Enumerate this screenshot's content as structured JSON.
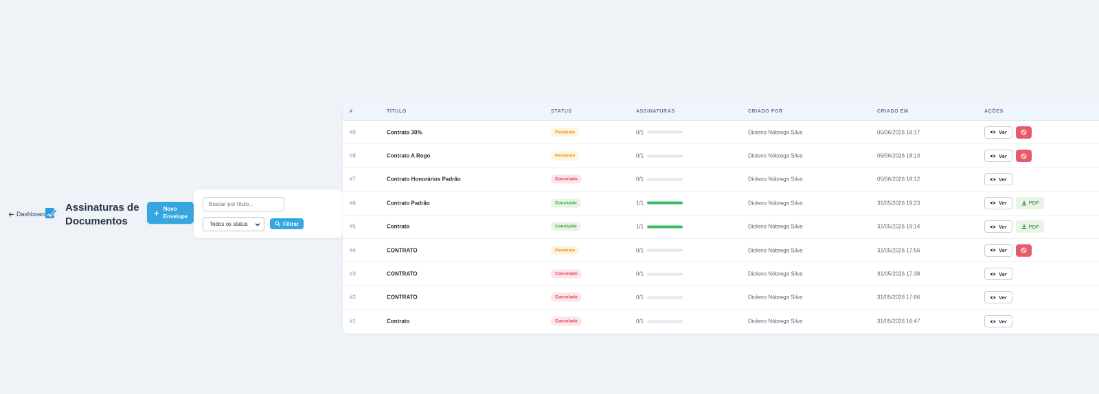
{
  "nav": {
    "back_label": "Dashboard"
  },
  "header": {
    "title": "Assinaturas de Documentos",
    "title_icon": "signature-icon"
  },
  "new_button": {
    "label": "Novo Envelope",
    "icon": "plus-icon"
  },
  "filters": {
    "search_placeholder": "Buscar por título...",
    "search_value": "",
    "status_selected": "Todos os status",
    "filter_label": "Filtrar"
  },
  "table": {
    "headers": {
      "id": "#",
      "title": "TÍTULO",
      "status": "STATUS",
      "signatures": "ASSINATURAS",
      "created_by": "CRIADO POR",
      "created_at": "CRIADO EM",
      "actions": "AÇÕES"
    },
    "view_label": "Ver",
    "pdf_label": "PDF",
    "rows": [
      {
        "id": "#9",
        "title": "Contrato 30%",
        "status": "Pendente",
        "status_kind": "pending",
        "signatures": "0/1",
        "progress": 0,
        "created_by": "Dioleno Nóbrega Silva",
        "created_at": "05/06/2026 18:17",
        "cancel": true,
        "pdf": false
      },
      {
        "id": "#8",
        "title": "Contrato A Rogo",
        "status": "Pendente",
        "status_kind": "pending",
        "signatures": "0/1",
        "progress": 0,
        "created_by": "Dioleno Nóbrega Silva",
        "created_at": "05/06/2026 18:13",
        "cancel": true,
        "pdf": false
      },
      {
        "id": "#7",
        "title": "Contrato Honorários Padrão",
        "status": "Cancelado",
        "status_kind": "cancelled",
        "signatures": "0/1",
        "progress": 0,
        "created_by": "Dioleno Nóbrega Silva",
        "created_at": "05/06/2026 18:12",
        "cancel": false,
        "pdf": false
      },
      {
        "id": "#6",
        "title": "Contrato Padrão",
        "status": "Concluído",
        "status_kind": "done",
        "signatures": "1/1",
        "progress": 1,
        "created_by": "Dioleno Nóbrega Silva",
        "created_at": "31/05/2026 19:23",
        "cancel": false,
        "pdf": true
      },
      {
        "id": "#5",
        "title": "Contrato",
        "status": "Concluído",
        "status_kind": "done",
        "signatures": "1/1",
        "progress": 1,
        "created_by": "Dioleno Nóbrega Silva",
        "created_at": "31/05/2026 19:14",
        "cancel": false,
        "pdf": true
      },
      {
        "id": "#4",
        "title": "CONTRATO",
        "status": "Pendente",
        "status_kind": "pending",
        "signatures": "0/1",
        "progress": 0,
        "created_by": "Dioleno Nóbrega Silva",
        "created_at": "31/05/2026 17:56",
        "cancel": true,
        "pdf": false
      },
      {
        "id": "#3",
        "title": "CONTRATO",
        "status": "Cancelado",
        "status_kind": "cancelled",
        "signatures": "0/1",
        "progress": 0,
        "created_by": "Dioleno Nóbrega Silva",
        "created_at": "31/05/2026 17:38",
        "cancel": false,
        "pdf": false
      },
      {
        "id": "#2",
        "title": "CONTRATO",
        "status": "Cancelado",
        "status_kind": "cancelled",
        "signatures": "0/1",
        "progress": 0,
        "created_by": "Dioleno Nóbrega Silva",
        "created_at": "31/05/2026 17:06",
        "cancel": false,
        "pdf": false
      },
      {
        "id": "#1",
        "title": "Contrato",
        "status": "Cancelado",
        "status_kind": "cancelled",
        "signatures": "0/1",
        "progress": 0,
        "created_by": "Dioleno Nóbrega Silva",
        "created_at": "31/05/2026 16:47",
        "cancel": false,
        "pdf": false
      }
    ]
  },
  "status_colors": {
    "pending": {
      "bg": "#fff3dc",
      "fg": "#e19a1c"
    },
    "cancelled": {
      "bg": "#fde4e6",
      "fg": "#e0445a"
    },
    "done": {
      "bg": "#e6f6e3",
      "fg": "#46a447"
    }
  },
  "colors": {
    "accent": "#35a6df",
    "danger": "#e75a6c",
    "background": "#eff3f8"
  }
}
